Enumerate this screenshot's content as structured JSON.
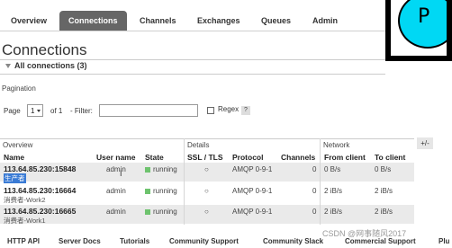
{
  "nav": {
    "tabs": [
      {
        "label": "Overview",
        "active": false
      },
      {
        "label": "Connections",
        "active": true
      },
      {
        "label": "Channels",
        "active": false
      },
      {
        "label": "Exchanges",
        "active": false
      },
      {
        "label": "Queues",
        "active": false
      },
      {
        "label": "Admin",
        "active": false
      }
    ],
    "logo_letter": "P"
  },
  "page": {
    "title": "Connections",
    "section_label": "All connections (3)"
  },
  "pagination": {
    "label": "Pagination",
    "page_label": "Page",
    "page_value": "1",
    "of_label": "of 1",
    "filter_label": "- Filter:",
    "filter_value": "",
    "regex_label": "Regex",
    "help_label": "?"
  },
  "table": {
    "groups": {
      "overview": "Overview",
      "details": "Details",
      "network": "Network"
    },
    "plus_minus": "+/-",
    "columns": [
      "Name",
      "User name",
      "State",
      "SSL / TLS",
      "Protocol",
      "Channels",
      "From client",
      "To client"
    ],
    "rows": [
      {
        "name": "113.64.85.230:15848",
        "sub": "生产者",
        "user": "admin",
        "state": "running",
        "ssl": "○",
        "protocol": "AMQP 0-9-1",
        "channels": "0",
        "from": "0 B/s",
        "to": "0 B/s"
      },
      {
        "name": "113.64.85.230:16664",
        "sub": "消费者-Work2",
        "user": "admin",
        "state": "running",
        "ssl": "○",
        "protocol": "AMQP 0-9-1",
        "channels": "0",
        "from": "2 iB/s",
        "to": "2 iB/s"
      },
      {
        "name": "113.64.85.230:16665",
        "sub": "消费者-Work1",
        "user": "admin",
        "state": "running",
        "ssl": "○",
        "protocol": "AMQP 0-9-1",
        "channels": "0",
        "from": "2 iB/s",
        "to": "2 iB/s"
      }
    ]
  },
  "footer": {
    "links": [
      "HTTP API",
      "Server Docs",
      "Tutorials",
      "Community Support",
      "Community Slack",
      "Commercial Support",
      "Plu"
    ],
    "watermark": "CSDN @网事随风2017"
  },
  "colors": {
    "active_tab": "#666666",
    "running": "#6ec36e",
    "logo": "#00d8f4",
    "highlight": "#3a7bd5"
  }
}
